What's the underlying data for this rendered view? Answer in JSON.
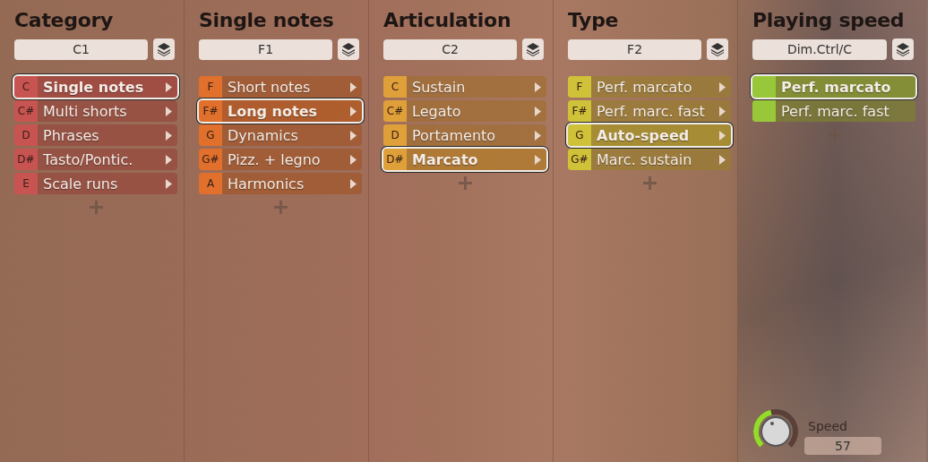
{
  "columns": [
    {
      "title": "Category",
      "field": "C1",
      "color": "#c85452",
      "kind": "keyed",
      "items": [
        {
          "key": "C",
          "label": "Single notes",
          "selected": true
        },
        {
          "key": "C#",
          "label": "Multi shorts",
          "selected": false
        },
        {
          "key": "D",
          "label": "Phrases",
          "selected": false
        },
        {
          "key": "D#",
          "label": "Tasto/Pontic.",
          "selected": false
        },
        {
          "key": "E",
          "label": "Scale runs",
          "selected": false
        }
      ]
    },
    {
      "title": "Single notes",
      "field": "F1",
      "color": "#e0702c",
      "kind": "keyed",
      "items": [
        {
          "key": "F",
          "label": "Short notes",
          "selected": false
        },
        {
          "key": "F#",
          "label": "Long notes",
          "selected": true
        },
        {
          "key": "G",
          "label": "Dynamics",
          "selected": false
        },
        {
          "key": "G#",
          "label": "Pizz. + legno",
          "selected": false
        },
        {
          "key": "A",
          "label": "Harmonics",
          "selected": false
        }
      ]
    },
    {
      "title": "Articulation",
      "field": "C2",
      "color": "#dfa03a",
      "kind": "keyed",
      "items": [
        {
          "key": "C",
          "label": "Sustain",
          "selected": false
        },
        {
          "key": "C#",
          "label": "Legato",
          "selected": false
        },
        {
          "key": "D",
          "label": "Portamento",
          "selected": false
        },
        {
          "key": "D#",
          "label": "Marcato",
          "selected": true
        }
      ]
    },
    {
      "title": "Type",
      "field": "F2",
      "color": "#cfc238",
      "kind": "keyed",
      "items": [
        {
          "key": "F",
          "label": "Perf. marcato",
          "selected": false
        },
        {
          "key": "F#",
          "label": "Perf. marc. fast",
          "selected": false
        },
        {
          "key": "G",
          "label": "Auto-speed",
          "selected": true
        },
        {
          "key": "G#",
          "label": "Marc. sustain",
          "selected": false
        }
      ]
    },
    {
      "title": "Playing speed",
      "field": "Dim.Ctrl/C",
      "color": "#98c83a",
      "kind": "plain",
      "items": [
        {
          "label": "Perf. marcato",
          "selected": true
        },
        {
          "label": "Perf. marc. fast",
          "selected": false
        }
      ]
    }
  ],
  "speed": {
    "label": "Speed",
    "value": "57"
  }
}
